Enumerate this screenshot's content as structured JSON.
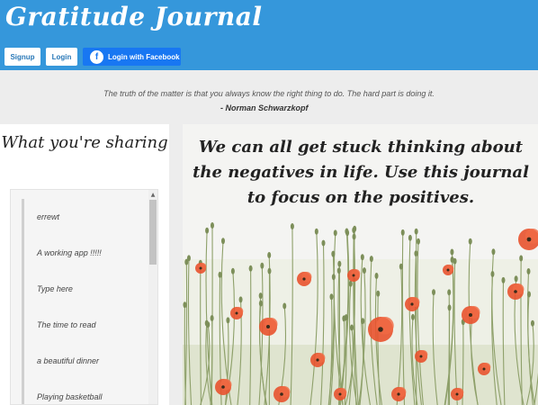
{
  "header": {
    "app_title": "Gratitude Journal",
    "buttons": {
      "signup": "Signup",
      "login": "Login",
      "facebook": "Login with Facebook"
    },
    "colors": {
      "bar": "#3597db",
      "facebook": "#1877f2"
    }
  },
  "quote": {
    "text": "The truth of the matter is that you always know the right thing to do. The hard part is doing it.",
    "author": "- Norman Schwarzkopf"
  },
  "sharing": {
    "title": "What you're sharing",
    "entries": [
      "errewt",
      "A working app !!!!!",
      "Type here",
      "The time to read",
      "a beautiful dinner",
      "Playing basketball"
    ]
  },
  "hero": {
    "text": "We can all get stuck thinking about the negatives in life. Use this journal to focus on the positives.",
    "image": "poppy-field"
  }
}
